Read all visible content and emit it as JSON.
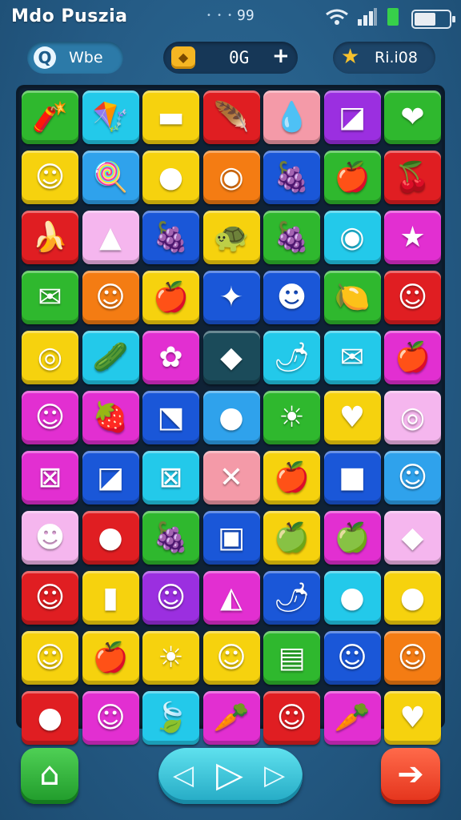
{
  "status": {
    "app_title": "Mdo Puszia",
    "dots": "• • •",
    "clock": "99",
    "wifi_icon": "wifi-icon",
    "signal_icon": "signal-bars-icon",
    "battery_icon": "battery-icon"
  },
  "header": {
    "mode_icon": "Q",
    "mode_label": "Wbe",
    "coin_icon": "◆",
    "score": "0G",
    "add": "+",
    "level_icon": "★",
    "level_label": "Ri.i08"
  },
  "colors": {
    "green": "#2fb82e",
    "cyan": "#23c9ea",
    "yellow": "#f6d20e",
    "red": "#e01e22",
    "pink": "#f49aa8",
    "purple": "#9b2fe0",
    "orange": "#f47c13",
    "magenta": "#e22fd1",
    "blue": "#1a57d8",
    "lightpink": "#f5b6ee",
    "teal": "#1b4b5a",
    "skyblue": "#2fa2ec"
  },
  "board": [
    [
      {
        "c": "green",
        "i": "🧨"
      },
      {
        "c": "cyan",
        "i": "🪁"
      },
      {
        "c": "yellow",
        "i": "▬"
      },
      {
        "c": "red",
        "i": "🪶"
      },
      {
        "c": "pink",
        "i": "💧"
      },
      {
        "c": "purple",
        "i": "◪"
      },
      {
        "c": "green",
        "i": "❤"
      }
    ],
    [
      {
        "c": "yellow",
        "i": "☺"
      },
      {
        "c": "skyblue",
        "i": "🍭"
      },
      {
        "c": "yellow",
        "i": "●"
      },
      {
        "c": "orange",
        "i": "◉"
      },
      {
        "c": "blue",
        "i": "🍇"
      },
      {
        "c": "green",
        "i": "🍎"
      },
      {
        "c": "red",
        "i": "🍒"
      }
    ],
    [
      {
        "c": "red",
        "i": "🍌"
      },
      {
        "c": "lightpink",
        "i": "▲"
      },
      {
        "c": "blue",
        "i": "🍇"
      },
      {
        "c": "yellow",
        "i": "🐢"
      },
      {
        "c": "green",
        "i": "🍇"
      },
      {
        "c": "cyan",
        "i": "◉"
      },
      {
        "c": "magenta",
        "i": "★"
      }
    ],
    [
      {
        "c": "green",
        "i": "✉"
      },
      {
        "c": "orange",
        "i": "☺"
      },
      {
        "c": "yellow",
        "i": "🍎"
      },
      {
        "c": "blue",
        "i": "✦"
      },
      {
        "c": "blue",
        "i": "☻"
      },
      {
        "c": "green",
        "i": "🍋"
      },
      {
        "c": "red",
        "i": "☺"
      }
    ],
    [
      {
        "c": "yellow",
        "i": "◎"
      },
      {
        "c": "cyan",
        "i": "🥒"
      },
      {
        "c": "magenta",
        "i": "✿"
      },
      {
        "c": "teal",
        "i": "◆"
      },
      {
        "c": "cyan",
        "i": "🌶"
      },
      {
        "c": "cyan",
        "i": "✉"
      },
      {
        "c": "magenta",
        "i": "🍎"
      }
    ],
    [
      {
        "c": "magenta",
        "i": "☺"
      },
      {
        "c": "magenta",
        "i": "🍓"
      },
      {
        "c": "blue",
        "i": "⬔"
      },
      {
        "c": "skyblue",
        "i": "●"
      },
      {
        "c": "green",
        "i": "☀"
      },
      {
        "c": "yellow",
        "i": "♥"
      },
      {
        "c": "lightpink",
        "i": "◎"
      }
    ],
    [
      {
        "c": "magenta",
        "i": "⊠"
      },
      {
        "c": "blue",
        "i": "◪"
      },
      {
        "c": "cyan",
        "i": "⊠"
      },
      {
        "c": "pink",
        "i": "✕"
      },
      {
        "c": "yellow",
        "i": "🍎"
      },
      {
        "c": "blue",
        "i": "■"
      },
      {
        "c": "skyblue",
        "i": "☺"
      }
    ],
    [
      {
        "c": "lightpink",
        "i": "☻"
      },
      {
        "c": "red",
        "i": "●"
      },
      {
        "c": "green",
        "i": "🍇"
      },
      {
        "c": "blue",
        "i": "▣"
      },
      {
        "c": "yellow",
        "i": "🍏"
      },
      {
        "c": "magenta",
        "i": "🍏"
      },
      {
        "c": "lightpink",
        "i": "◆"
      }
    ],
    [
      {
        "c": "red",
        "i": "☺"
      },
      {
        "c": "yellow",
        "i": "▮"
      },
      {
        "c": "purple",
        "i": "☺"
      },
      {
        "c": "magenta",
        "i": "◭"
      },
      {
        "c": "blue",
        "i": "🌶"
      },
      {
        "c": "cyan",
        "i": "●"
      },
      {
        "c": "yellow",
        "i": "●"
      }
    ],
    [
      {
        "c": "yellow",
        "i": "☺"
      },
      {
        "c": "yellow",
        "i": "🍎"
      },
      {
        "c": "yellow",
        "i": "☀"
      },
      {
        "c": "yellow",
        "i": "☺"
      },
      {
        "c": "green",
        "i": "▤"
      },
      {
        "c": "blue",
        "i": "☺"
      },
      {
        "c": "orange",
        "i": "☺"
      }
    ],
    [
      {
        "c": "red",
        "i": "●"
      },
      {
        "c": "magenta",
        "i": "☺"
      },
      {
        "c": "cyan",
        "i": "🍃"
      },
      {
        "c": "magenta",
        "i": "🥕"
      },
      {
        "c": "red",
        "i": "☺"
      },
      {
        "c": "magenta",
        "i": "🥕"
      },
      {
        "c": "yellow",
        "i": "♥"
      }
    ]
  ],
  "controls": {
    "home_icon": "⌂",
    "prev_icon": "◁",
    "play_icon": "▷",
    "next_icon": "▷",
    "forward_icon": "➔"
  }
}
